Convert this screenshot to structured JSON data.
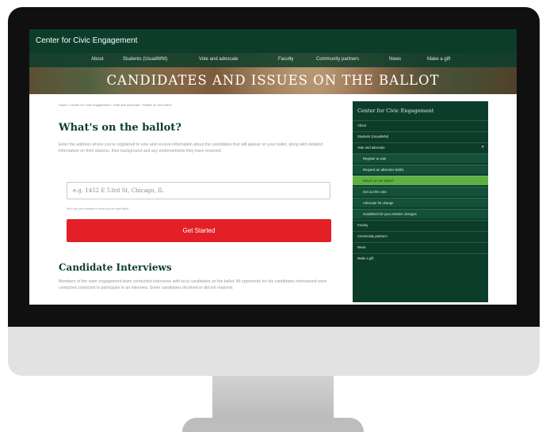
{
  "site": {
    "title": "Center for Civic Engagement",
    "hero_title": "CANDIDATES AND ISSUES ON THE BALLOT"
  },
  "nav": {
    "items": [
      "About",
      "Students (UsualWNI)",
      "Vote and advocate",
      "Faculty",
      "Community partners",
      "News",
      "Make a gift"
    ]
  },
  "breadcrumb": "Home › Center for Civic Engagement › Vote and advocate › What's on the ballot?",
  "main": {
    "heading": "What's on the ballot?",
    "intro": "Enter the address where you're registered to vote and receive information about the candidates that will appear on your ballot, along with detailed information on their stances, their background and any endorsements they have received.",
    "address_placeholder": "e.g. 1452 E 53rd St, Chicago, IL",
    "help_text": "We'll use your address to show you the right ballot.",
    "get_started_label": "Get Started",
    "interviews_heading": "Candidate Interviews",
    "interviews_text": "Members of the voter engagement team conducted interviews with local candidates on the ballot. All opponents for the candidates interviewed were contacted contacted to participate in an interview. Some candidates declined or did not respond."
  },
  "sidebar": {
    "title": "Center for Civic Engagement",
    "items": [
      {
        "label": "About"
      },
      {
        "label": "Students (UsualWNI)"
      },
      {
        "label": "Vote and advocate"
      },
      {
        "label": "Register to vote"
      },
      {
        "label": "Request an absentee ballot"
      },
      {
        "label": "What's on the ballot?"
      },
      {
        "label": "Get out the vote"
      },
      {
        "label": "Advocate for change"
      },
      {
        "label": "Guidelines for your election changes"
      },
      {
        "label": "Faculty"
      },
      {
        "label": "Community partners"
      },
      {
        "label": "News"
      },
      {
        "label": "Make a gift"
      }
    ]
  },
  "icons": {
    "expand": "chevron-down-icon"
  },
  "colors": {
    "brand_green": "#0c3d2b",
    "cta_red": "#e32025",
    "active_green": "#5cb044"
  }
}
